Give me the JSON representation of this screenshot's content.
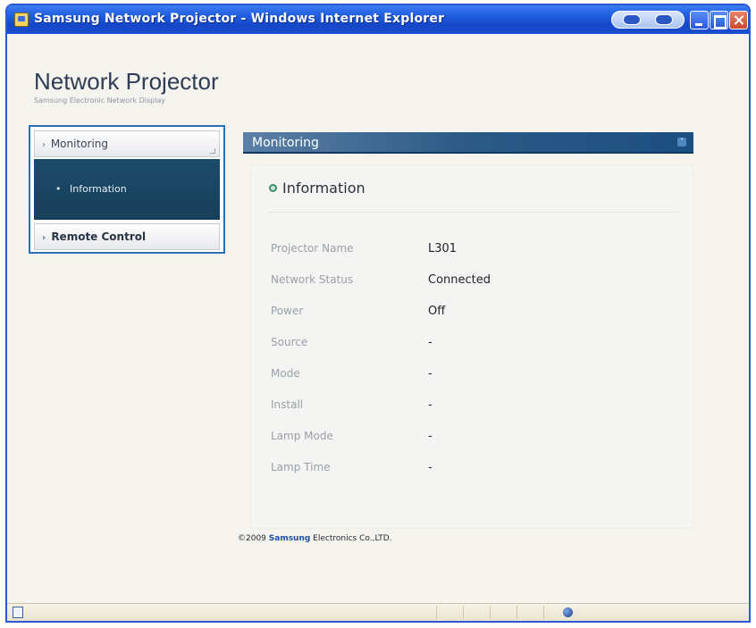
{
  "window": {
    "title": "Samsung Network Projector - Windows Internet Explorer"
  },
  "app": {
    "title": "Network Projector",
    "subtitle": "Samsung Electronic Network Display"
  },
  "sidebar": {
    "items": [
      {
        "label": "Monitoring"
      },
      {
        "label": "Information"
      },
      {
        "label": "Remote Control"
      }
    ]
  },
  "section": {
    "title": "Monitoring"
  },
  "panel": {
    "title": "Information",
    "rows": [
      {
        "label": "Projector Name",
        "value": "L301"
      },
      {
        "label": "Network Status",
        "value": "Connected"
      },
      {
        "label": "Power",
        "value": "Off"
      },
      {
        "label": "Source",
        "value": "-"
      },
      {
        "label": "Mode",
        "value": "-"
      },
      {
        "label": "Install",
        "value": "-"
      },
      {
        "label": "Lamp Mode",
        "value": "-"
      },
      {
        "label": "Lamp Time",
        "value": "-"
      }
    ]
  },
  "footer": {
    "prefix": "©2009 ",
    "brand": "Samsung",
    "suffix": " Electronics Co.,LTD."
  },
  "colors": {
    "titlebar": "#1f5fe0",
    "sidebar_border": "#2f6fb5",
    "sidebar_active": "#1c4c6b",
    "section_header": "#2b5a86",
    "brand": "#1d4fa8"
  }
}
